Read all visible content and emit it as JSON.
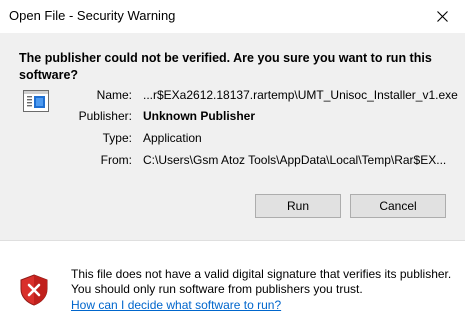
{
  "window": {
    "title": "Open File - Security Warning"
  },
  "dialog": {
    "heading": "The publisher could not be verified.  Are you sure you want to run this software?",
    "details": [
      {
        "label": "Name:",
        "value": "...r$EXa2612.18137.rartemp\\UMT_Unisoc_Installer_v1.exe",
        "bold": false
      },
      {
        "label": "Publisher:",
        "value": "Unknown Publisher",
        "bold": true
      },
      {
        "label": "Type:",
        "value": "Application",
        "bold": false
      },
      {
        "label": "From:",
        "value": "C:\\Users\\Gsm Atoz Tools\\AppData\\Local\\Temp\\Rar$EX...",
        "bold": false
      }
    ],
    "run_label": "Run",
    "cancel_label": "Cancel"
  },
  "footer": {
    "warning_text": "This file does not have a valid digital signature that verifies its publisher.  You should only run software from publishers you trust.",
    "help_link": "How can I decide what software to run?"
  },
  "icons": {
    "close": "close-icon",
    "file": "application-file-icon",
    "shield": "shield-error-icon"
  },
  "colors": {
    "link": "#0066cc",
    "shield_red": "#d9302b",
    "file_blue": "#1f6fd1"
  }
}
